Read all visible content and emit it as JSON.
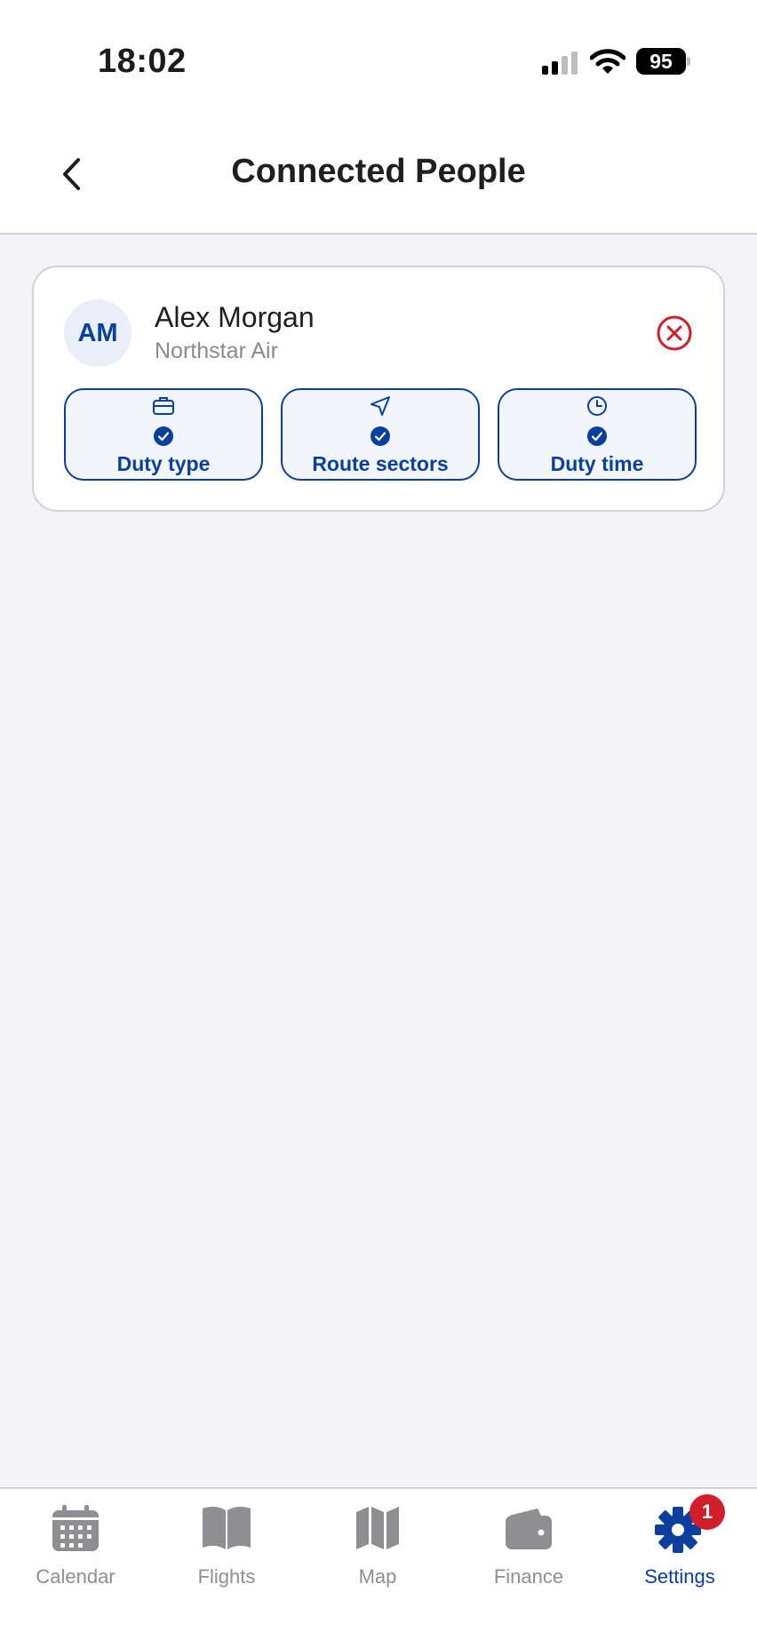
{
  "status_bar": {
    "time": "18:02",
    "battery": "95",
    "icons": [
      "cellular-signal-icon",
      "wifi-icon",
      "battery-icon"
    ]
  },
  "header": {
    "title": "Connected People",
    "back_icon": "chevron-left-icon"
  },
  "person": {
    "initials": "AM",
    "name": "Alex Morgan",
    "company": "Northstar Air",
    "remove_icon": "remove-circle-icon",
    "permissions": [
      {
        "label": "Duty type",
        "icon": "briefcase-icon",
        "checked": true
      },
      {
        "label": "Route sectors",
        "icon": "navigation-arrow-icon",
        "checked": true
      },
      {
        "label": "Duty time",
        "icon": "clock-icon",
        "checked": true
      }
    ]
  },
  "tabs": [
    {
      "label": "Calendar",
      "icon": "calendar-icon",
      "active": false
    },
    {
      "label": "Flights",
      "icon": "book-icon",
      "active": false
    },
    {
      "label": "Map",
      "icon": "map-icon",
      "active": false
    },
    {
      "label": "Finance",
      "icon": "wallet-icon",
      "active": false
    },
    {
      "label": "Settings",
      "icon": "gear-icon",
      "active": true,
      "badge": "1"
    }
  ],
  "colors": {
    "accent": "#0b3f9e",
    "danger": "#d11f2a",
    "inactive": "#8e8e93",
    "background": "#f4f4f6"
  }
}
